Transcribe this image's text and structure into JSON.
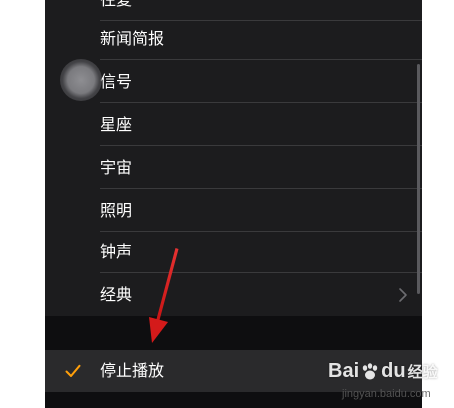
{
  "menu": {
    "items": [
      {
        "label": "往复"
      },
      {
        "label": "新闻简报"
      },
      {
        "label": "信号"
      },
      {
        "label": "星座"
      },
      {
        "label": "宇宙"
      },
      {
        "label": "照明"
      },
      {
        "label": "钟声"
      },
      {
        "label": "经典",
        "has_chevron": true
      }
    ]
  },
  "stop": {
    "label": "停止播放",
    "checked": true
  },
  "watermark": {
    "brand": "Bai  经验",
    "url": "jingyan.baidu.com"
  },
  "colors": {
    "background": "#1c1c1e",
    "divider": "#3a3a3c",
    "check": "#ff9f0a",
    "arrow": "#e02020",
    "text": "#ffffff"
  }
}
